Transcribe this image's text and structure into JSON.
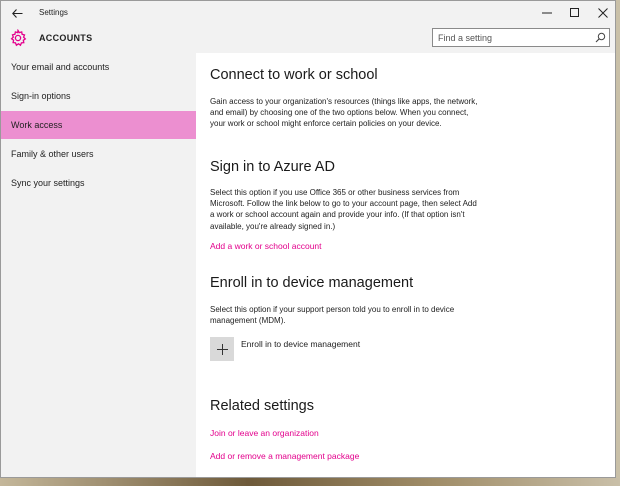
{
  "window": {
    "title": "Settings",
    "back_icon": "back-arrow-icon",
    "controls": [
      "minimize-icon",
      "maximize-icon",
      "close-icon"
    ]
  },
  "header": {
    "section": "ACCOUNTS",
    "icon": "gear-icon",
    "accent": "#e3008c",
    "search_placeholder": "Find a setting"
  },
  "sidebar": {
    "items": [
      {
        "label": "Your email and accounts",
        "selected": false
      },
      {
        "label": "Sign-in options",
        "selected": false
      },
      {
        "label": "Work access",
        "selected": true
      },
      {
        "label": "Family & other users",
        "selected": false
      },
      {
        "label": "Sync your settings",
        "selected": false
      }
    ],
    "selected_color": "#ec8fd0"
  },
  "main": {
    "connect": {
      "heading": "Connect to work or school",
      "body": "Gain access to your organization's resources (things like apps, the network, and email) by choosing one of the two options below. When you connect, your work or school might enforce certain policies on your device."
    },
    "azure": {
      "heading": "Sign in to Azure AD",
      "body": "Select this option if you use Office 365 or other business services from Microsoft. Follow the link below to go to your account page, then select Add a work or school account again and provide your info. (If that option isn't available, you're already signed in.)",
      "link": "Add a work or school account"
    },
    "enroll": {
      "heading": "Enroll in to device management",
      "body": "Select this option if your support person told you to enroll in to device management (MDM).",
      "button_label": "Enroll in to device management"
    },
    "related": {
      "heading": "Related settings",
      "links": [
        "Join or leave an organization",
        "Add or remove a management package"
      ]
    }
  }
}
